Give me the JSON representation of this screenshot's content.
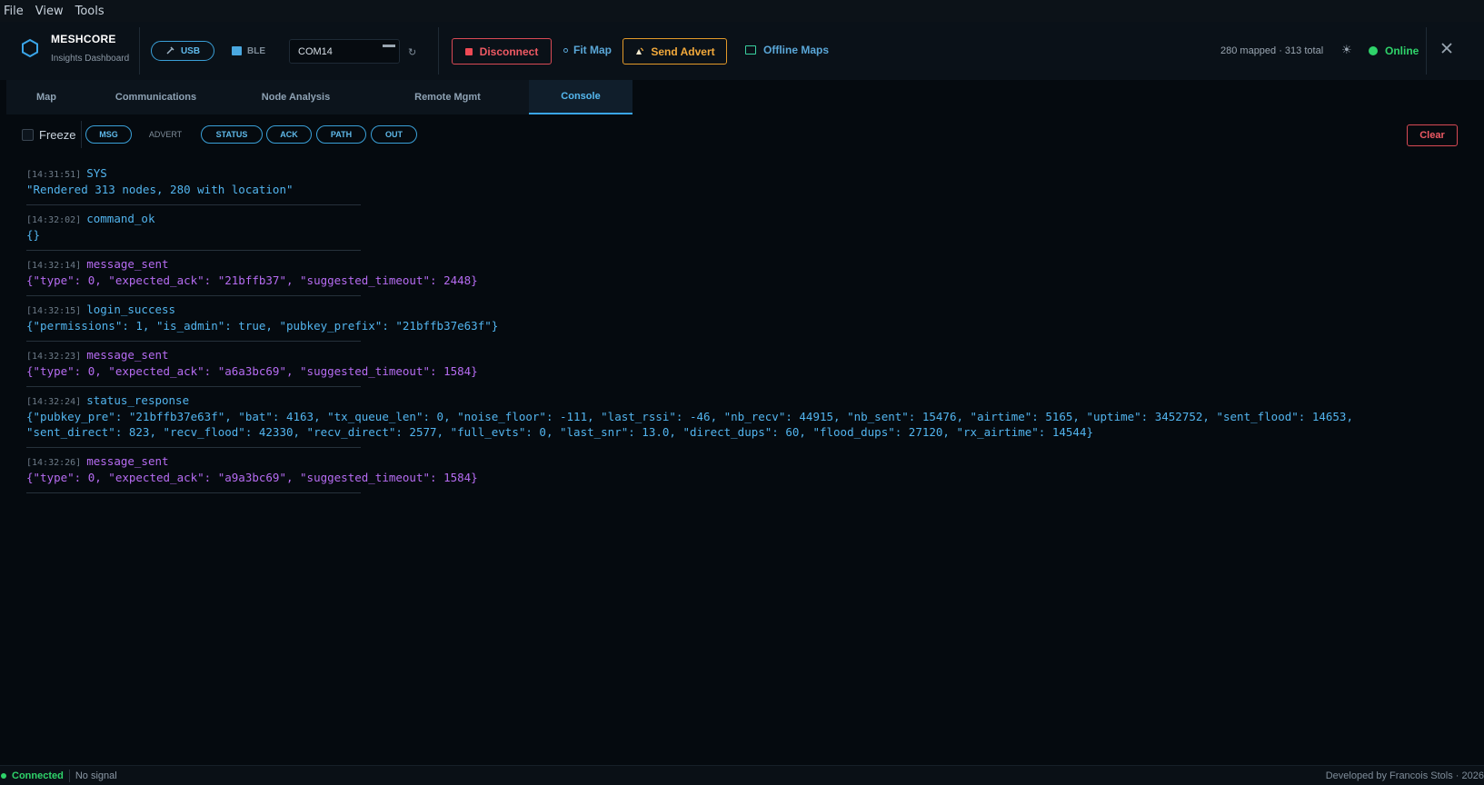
{
  "menu": [
    "File",
    "View",
    "Tools"
  ],
  "brand": {
    "title": "MESHCORE",
    "subtitle": "Insights Dashboard"
  },
  "connection": {
    "usb_label": "USB",
    "ble_label": "BLE",
    "port_value": "COM14",
    "disconnect_label": "Disconnect",
    "fit_map_label": "Fit Map",
    "send_advert_label": "Send Advert",
    "offline_maps_label": "Offline Maps"
  },
  "header_status": {
    "counts": "280 mapped · 313 total",
    "online_label": "Online"
  },
  "tabs": [
    {
      "label": "Map",
      "active": false
    },
    {
      "label": "Communications",
      "active": false
    },
    {
      "label": "Node Analysis",
      "active": false
    },
    {
      "label": "Remote Mgmt",
      "active": false
    },
    {
      "label": "Console",
      "active": true
    }
  ],
  "toolbar": {
    "freeze_label": "Freeze",
    "filters": [
      {
        "label": "MSG",
        "active": true
      },
      {
        "label": "ADVERT",
        "active": false
      },
      {
        "label": "STATUS",
        "active": true
      },
      {
        "label": "ACK",
        "active": true
      },
      {
        "label": "PATH",
        "active": true
      },
      {
        "label": "OUT",
        "active": true
      }
    ],
    "clear_label": "Clear"
  },
  "console": {
    "entries": [
      {
        "time": "[14:31:51]",
        "event": "SYS",
        "payload": "\"Rendered 313 nodes, 280 with location\"",
        "color": "#52b4ee"
      },
      {
        "time": "[14:32:02]",
        "event": "command_ok",
        "payload": "{}",
        "color": "#52b4ee"
      },
      {
        "time": "[14:32:14]",
        "event": "message_sent",
        "payload": "{\"type\": 0, \"expected_ack\": \"21bffb37\", \"suggested_timeout\": 2448}",
        "color": "#b66cf2"
      },
      {
        "time": "[14:32:15]",
        "event": "login_success",
        "payload": "{\"permissions\": 1, \"is_admin\": true, \"pubkey_prefix\": \"21bffb37e63f\"}",
        "color": "#52b4ee"
      },
      {
        "time": "[14:32:23]",
        "event": "message_sent",
        "payload": "{\"type\": 0, \"expected_ack\": \"a6a3bc69\", \"suggested_timeout\": 1584}",
        "color": "#b66cf2"
      },
      {
        "time": "[14:32:24]",
        "event": "status_response",
        "payload": "{\"pubkey_pre\": \"21bffb37e63f\", \"bat\": 4163, \"tx_queue_len\": 0, \"noise_floor\": -111, \"last_rssi\": -46, \"nb_recv\": 44915, \"nb_sent\": 15476, \"airtime\": 5165, \"uptime\": 3452752, \"sent_flood\": 14653,\n\"sent_direct\": 823, \"recv_flood\": 42330, \"recv_direct\": 2577, \"full_evts\": 0, \"last_snr\": 13.0, \"direct_dups\": 60, \"flood_dups\": 27120, \"rx_airtime\": 14544}",
        "color": "#52b4ee"
      },
      {
        "time": "[14:32:26]",
        "event": "message_sent",
        "payload": "{\"type\": 0, \"expected_ack\": \"a9a3bc69\", \"suggested_timeout\": 1584}",
        "color": "#b66cf2"
      }
    ]
  },
  "statusbar": {
    "connected_label": "Connected",
    "signal_label": "No signal",
    "developer": "Developed by Francois Stols · 2026"
  },
  "colors": {
    "accent": "#3aa5e8",
    "online": "#2fd36a",
    "danger": "#ef5a64",
    "warning": "#f2a93b",
    "purple": "#b66cf2"
  }
}
